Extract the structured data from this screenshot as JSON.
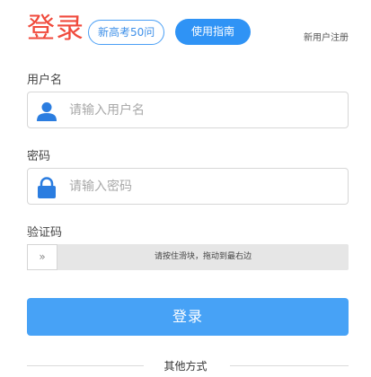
{
  "header": {
    "title": "登录",
    "tag_outline": "新高考50问",
    "tag_solid": "使用指南",
    "register_link": "新用户注册"
  },
  "username": {
    "label": "用户名",
    "placeholder": "请输入用户名",
    "value": "",
    "icon": "user-icon"
  },
  "password": {
    "label": "密码",
    "placeholder": "请输入密码",
    "value": "",
    "icon": "lock-icon"
  },
  "captcha": {
    "label": "验证码",
    "handle": "»",
    "instruction": "请按住滑块，拖动到最右边"
  },
  "submit_label": "登录",
  "other_methods": "其他方式",
  "colors": {
    "title": "#f04a3c",
    "accent": "#2f93f5",
    "submit": "#47a2f6",
    "icon": "#2b7de0"
  }
}
